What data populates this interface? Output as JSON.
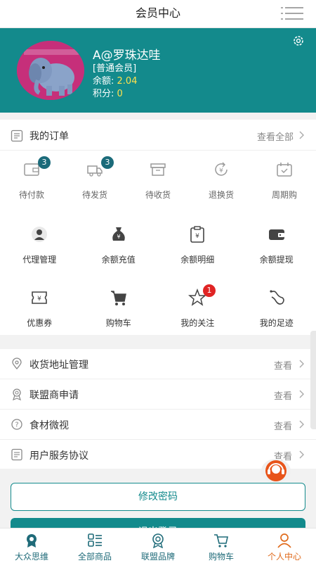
{
  "topbar": {
    "title": "会员中心",
    "menu_icon": "menu-icon"
  },
  "profile": {
    "username": "A@罗珠达哇",
    "level": "[普通会员]",
    "balance_label": "余额:",
    "balance_value": "2.04",
    "points_label": "积分:",
    "points_value": "0",
    "colors": {
      "header_bg": "#138a8c",
      "value": "#ffe14d"
    }
  },
  "orders": {
    "title": "我的订单",
    "view_all": "查看全部",
    "status": [
      {
        "label": "待付款",
        "icon": "wallet-icon",
        "badge": "3"
      },
      {
        "label": "待发货",
        "icon": "truck-icon",
        "badge": "3"
      },
      {
        "label": "待收货",
        "icon": "box-icon",
        "badge": ""
      },
      {
        "label": "退换货",
        "icon": "return-icon",
        "badge": ""
      },
      {
        "label": "周期购",
        "icon": "calendar-icon",
        "badge": ""
      }
    ]
  },
  "functions": {
    "row1": [
      {
        "label": "代理管理",
        "icon": "agent-icon"
      },
      {
        "label": "余额充值",
        "icon": "moneybag-icon"
      },
      {
        "label": "余额明细",
        "icon": "ledger-icon"
      },
      {
        "label": "余额提现",
        "icon": "withdraw-wallet-icon"
      }
    ],
    "row2": [
      {
        "label": "优惠券",
        "icon": "coupon-icon",
        "badge": ""
      },
      {
        "label": "购物车",
        "icon": "cart-icon",
        "badge": ""
      },
      {
        "label": "我的关注",
        "icon": "star-icon",
        "badge": "1"
      },
      {
        "label": "我的足迹",
        "icon": "footprint-icon",
        "badge": ""
      }
    ]
  },
  "list": [
    {
      "label": "收货地址管理",
      "action": "查看",
      "icon": "location-icon"
    },
    {
      "label": "联盟商申请",
      "action": "查看",
      "icon": "medal-icon"
    },
    {
      "label": "食材微视",
      "action": "查看",
      "icon": "help-icon"
    },
    {
      "label": "用户服务协议",
      "action": "查看",
      "icon": "document-icon"
    }
  ],
  "buttons": {
    "change_password": "修改密码",
    "logout": "退出登录"
  },
  "tabbar": [
    {
      "label": "大众思维",
      "icon": "badge-icon",
      "active": false
    },
    {
      "label": "全部商品",
      "icon": "grid-list-icon",
      "active": false
    },
    {
      "label": "联盟品牌",
      "icon": "ribbon-icon",
      "active": false
    },
    {
      "label": "购物车",
      "icon": "cart-icon",
      "active": false
    },
    {
      "label": "个人中心",
      "icon": "person-icon",
      "active": true
    }
  ]
}
